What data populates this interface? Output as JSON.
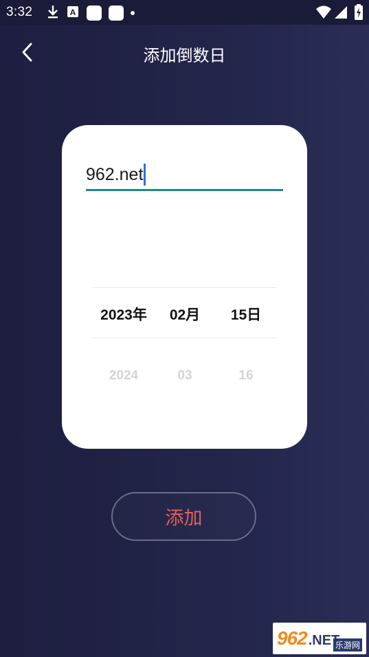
{
  "status_bar": {
    "time": "3:32",
    "left_icons": [
      "download-icon",
      "a-notification-icon",
      "app-square-icon",
      "app-square-icon",
      "more-dot-icon"
    ],
    "right_icons": [
      "wifi-icon",
      "cell-signal-icon",
      "battery-charging-icon"
    ]
  },
  "header": {
    "title": "添加倒数日",
    "back_icon": "chevron-left-icon"
  },
  "card": {
    "name_input_value": "962.net",
    "picker": {
      "year_selected": "2023年",
      "month_selected": "02月",
      "day_selected": "15日",
      "year_next": "2024",
      "month_next": "03",
      "day_next": "16"
    }
  },
  "add_button": {
    "label": "添加"
  },
  "watermark": {
    "brand_number": "962",
    "brand_suffix": ".NET",
    "brand_cn": "乐游网"
  },
  "colors": {
    "background": "#222449",
    "card": "#ffffff",
    "input_underline": "#1b8c7f",
    "cursor": "#2f6ee0",
    "add_label": "#e2615a",
    "picker_next": "#d4d4d4"
  }
}
